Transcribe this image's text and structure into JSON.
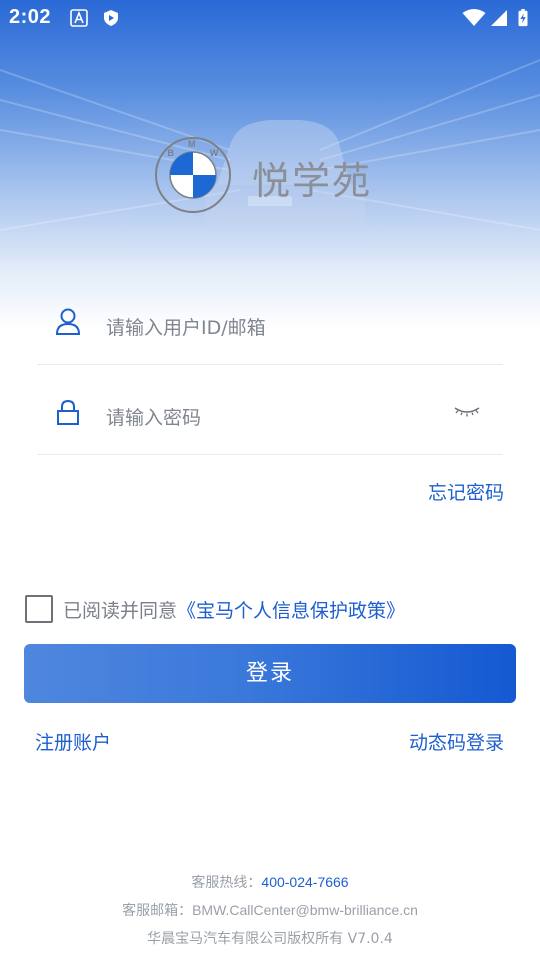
{
  "status_bar": {
    "time": "2:02",
    "left_icons": [
      "text-recognition-icon",
      "shield-play-icon"
    ],
    "right_icons": [
      "wifi-icon",
      "signal-icon",
      "battery-charging-icon"
    ]
  },
  "brand": {
    "logo_letters": [
      "B",
      "M",
      "W"
    ],
    "name": "悦学苑"
  },
  "form": {
    "user_placeholder": "请输入用户ID/邮箱",
    "password_placeholder": "请输入密码",
    "forgot_password": "忘记密码"
  },
  "agreement": {
    "prefix": "已阅读并同意",
    "policy_link": "《宝马个人信息保护政策》",
    "checked": false
  },
  "actions": {
    "login": "登录",
    "register": "注册账户",
    "sms_login": "动态码登录"
  },
  "footer": {
    "hotline_label": "客服热线：",
    "hotline_number": "400-024-7666",
    "email_label": "客服邮箱：",
    "email": "BMW.CallCenter@bmw-brilliance.cn",
    "copyright": "华晨宝马汽车有限公司版权所有 V7.0.4"
  },
  "colors": {
    "accent": "#1d5fcf",
    "button_start": "#4f87de",
    "button_end": "#1459d2",
    "hero_top": "#2a69d6",
    "muted_text": "#9aa0a8"
  }
}
